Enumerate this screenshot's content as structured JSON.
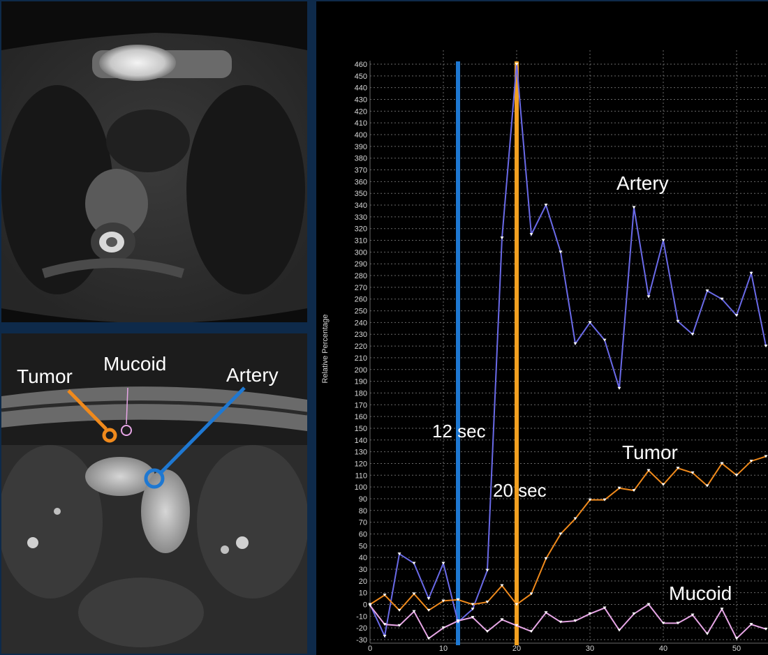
{
  "colors": {
    "artery": "#6a6ae8",
    "tumor": "#f08a1c",
    "mucoid": "#e7a6e6",
    "line_12": "#1e78d2",
    "line_20": "#f2a020",
    "grid": "#6a6a6a",
    "axis_text": "#d8d8d8",
    "label_text": "#ffffff"
  },
  "mri_top": {
    "icon": "axial-mri-t2-image"
  },
  "mri_bottom": {
    "icon": "axial-mri-contrast-image",
    "labels": {
      "tumor": "Tumor",
      "mucoid": "Mucoid",
      "artery": "Artery"
    }
  },
  "chart_data": {
    "type": "line",
    "title": "",
    "xlabel": "",
    "ylabel": "Relative Percentage",
    "xlim": [
      0,
      54
    ],
    "ylim": [
      -30,
      460
    ],
    "x_ticks": [
      0,
      10,
      20,
      30,
      40,
      50
    ],
    "y_ticks": [
      -30,
      -20,
      -10,
      0,
      10,
      20,
      30,
      40,
      50,
      60,
      70,
      80,
      90,
      100,
      110,
      120,
      130,
      140,
      150,
      160,
      170,
      180,
      190,
      200,
      210,
      220,
      230,
      240,
      250,
      260,
      270,
      280,
      290,
      300,
      310,
      320,
      330,
      340,
      350,
      360,
      370,
      380,
      390,
      400,
      410,
      420,
      430,
      440,
      450,
      460
    ],
    "grid": true,
    "annotations": [
      {
        "text": "12 sec",
        "x": 12,
        "line": "vertical"
      },
      {
        "text": "20 sec",
        "x": 20,
        "line": "vertical"
      }
    ],
    "series": [
      {
        "name": "Artery",
        "x": [
          0,
          2,
          4,
          6,
          8,
          10,
          12,
          14,
          16,
          18,
          20,
          22,
          24,
          26,
          28,
          30,
          32,
          34,
          36,
          38,
          40,
          42,
          44,
          46,
          48,
          50,
          52,
          54
        ],
        "y": [
          0,
          -27,
          43,
          35,
          5,
          35,
          -15,
          -4,
          29,
          312,
          460,
          315,
          340,
          300,
          222,
          240,
          225,
          184,
          338,
          262,
          310,
          241,
          230,
          267,
          260,
          246,
          282,
          220
        ]
      },
      {
        "name": "Tumor",
        "x": [
          0,
          2,
          4,
          6,
          8,
          10,
          12,
          14,
          16,
          18,
          20,
          22,
          24,
          26,
          28,
          30,
          32,
          34,
          36,
          38,
          40,
          42,
          44,
          46,
          48,
          50,
          52,
          54
        ],
        "y": [
          0,
          8,
          -5,
          9,
          -5,
          3,
          4,
          0,
          2,
          16,
          0,
          9,
          39,
          60,
          73,
          89,
          89,
          99,
          97,
          114,
          102,
          116,
          112,
          101,
          120,
          110,
          122,
          126
        ]
      },
      {
        "name": "Mucoid",
        "x": [
          0,
          2,
          4,
          6,
          8,
          10,
          12,
          14,
          16,
          18,
          20,
          22,
          24,
          26,
          28,
          30,
          32,
          34,
          36,
          38,
          40,
          42,
          44,
          46,
          48,
          50,
          52,
          54
        ],
        "y": [
          -1,
          -17,
          -18,
          -6,
          -29,
          -20,
          -14,
          -11,
          -23,
          -13,
          -18,
          -23,
          -7,
          -15,
          -14,
          -8,
          -3,
          -22,
          -8,
          0,
          -16,
          -16,
          -9,
          -25,
          -4,
          -29,
          -17,
          -21
        ]
      }
    ]
  }
}
